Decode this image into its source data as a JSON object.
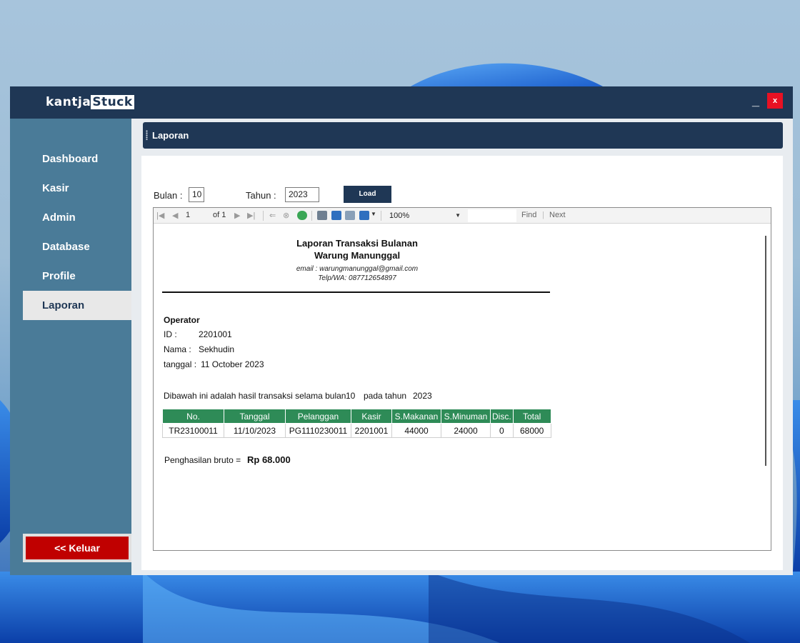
{
  "app": {
    "logo_left": "kantja",
    "logo_right": "Stuck",
    "minimize_label": "_",
    "close_label": "x"
  },
  "sidebar": {
    "items": [
      {
        "label": "Dashboard"
      },
      {
        "label": "Kasir"
      },
      {
        "label": "Admin"
      },
      {
        "label": "Database"
      },
      {
        "label": "Profile"
      },
      {
        "label": "Laporan"
      }
    ],
    "exit_label": "<< Keluar"
  },
  "header": {
    "title": "Laporan"
  },
  "filter": {
    "bulan_label": "Bulan :",
    "bulan_value": "10",
    "tahun_label": "Tahun :",
    "tahun_value": "2023",
    "load_label": "Load"
  },
  "toolbar": {
    "page_current": "1",
    "page_of": "of 1",
    "zoom": "100%",
    "find_label": "Find",
    "next_label": "Next"
  },
  "report": {
    "title": "Laporan Transaksi Bulanan",
    "store": "Warung Manunggal",
    "email": "email : warungmanunggal@gmail.com",
    "phone": "Telp/WA: 087712654897",
    "operator_heading": "Operator",
    "id_label": "ID :",
    "id_value": "2201001",
    "nama_label": "Nama :",
    "nama_value": "Sekhudin",
    "tanggal_label": "tanggal :",
    "tanggal_value": "11 October 2023",
    "sentence_prefix": "Dibawah ini adalah hasil transaksi selama bulan",
    "sentence_month": "10",
    "sentence_mid": "pada tahun",
    "sentence_year": "2023",
    "table": {
      "headers": [
        "No.",
        "Tanggal",
        "Pelanggan",
        "Kasir",
        "S.Makanan",
        "S.Minuman",
        "Disc.",
        "Total"
      ],
      "rows": [
        [
          "TR23100011",
          "11/10/2023",
          "PG1110230011",
          "2201001",
          "44000",
          "24000",
          "0",
          "68000"
        ]
      ]
    },
    "total_label": "Penghasilan bruto =",
    "total_value": "Rp 68.000"
  },
  "colors": {
    "titlebar": "#1f3755",
    "sidebar": "#4a7b98",
    "close": "#e81123",
    "exit": "#c00000",
    "table_header": "#2e8b57"
  }
}
